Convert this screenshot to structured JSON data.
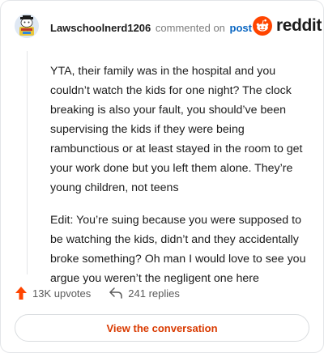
{
  "header": {
    "username": "Lawschoolnerd1206",
    "action_text": "commented on",
    "post_link": "post",
    "brand_name": "reddit"
  },
  "comment": {
    "paragraphs": [
      "YTA, their family was in the hospital and you couldn’t watch the kids for one night? The clock breaking is also your fault, you should’ve been supervising the kids if they were being rambunctious or at least stayed in the room to get your work done but you left them alone. They’re young children, not teens",
      "Edit: You’re suing because you were supposed to be watching the kids, didn’t and they accidentally broke something? Oh man I would love to see you argue you weren’t the negligent one here"
    ]
  },
  "actions": {
    "upvotes": "13K upvotes",
    "replies": "241 replies"
  },
  "view_button": "View the conversation",
  "colors": {
    "brand_orange": "#ff4500",
    "link_blue": "#0a66c2",
    "button_text": "#d93a00"
  },
  "icons": [
    "avatar-snoo",
    "reddit-logo-icon",
    "upvote-arrow-icon",
    "reply-arrow-icon"
  ]
}
